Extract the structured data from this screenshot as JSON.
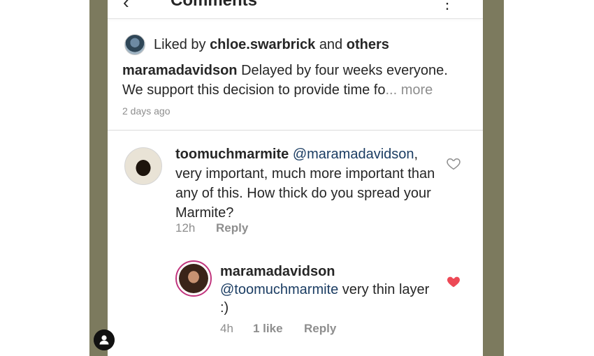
{
  "header": {
    "title": "Comments",
    "back_icon": "back-arrow-icon",
    "menu_icon": "more-options-icon"
  },
  "post": {
    "liked_by_prefix": "Liked by",
    "liked_by_user": "chloe.swarbrick",
    "liked_by_and": "and",
    "liked_by_others": "others",
    "caption_user": "maramadavidson",
    "caption_text": "Delayed by four weeks everyone. We support this decision to provide time fo",
    "caption_more": "... more",
    "time": "2 days ago"
  },
  "comments": [
    {
      "user": "toomuchmarmite",
      "mention": "@maramadavidson",
      "text": ", very important, much more important than any of this. How thick do you spread your Marmite?",
      "time": "12h",
      "reply_label": "Reply",
      "liked": false
    },
    {
      "user": "maramadavidson",
      "mention": "@toomuchmarmite",
      "text": " very thin layer :)",
      "time": "4h",
      "likes": "1 like",
      "reply_label": "Reply",
      "liked": true
    }
  ],
  "colors": {
    "frame": "#7c7a5e",
    "heart_active": "#ed4956",
    "mention": "#1b3d63",
    "muted": "#8e8e8e"
  }
}
